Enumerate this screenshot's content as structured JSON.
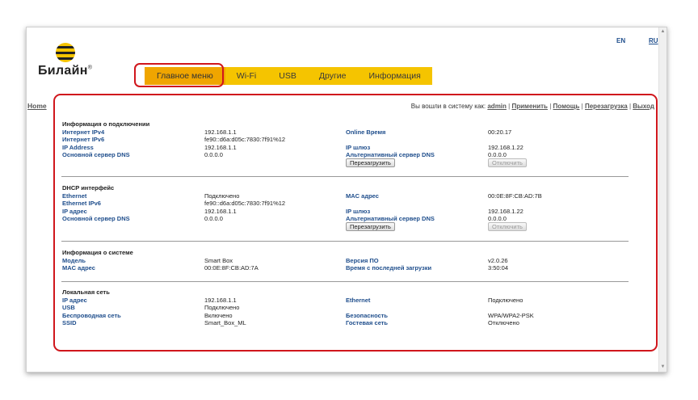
{
  "brand": {
    "name": "Билайн",
    "mark": "®"
  },
  "languages": {
    "en": "EN",
    "ru": "RU"
  },
  "menu": [
    {
      "label": "Главное меню",
      "active": true
    },
    {
      "label": "Wi-Fi"
    },
    {
      "label": "USB"
    },
    {
      "label": "Другие"
    },
    {
      "label": "Информация"
    }
  ],
  "home_link": "Home",
  "topbar": {
    "prefix": "Вы вошли в систему как:",
    "user": "admin",
    "apply": "Применить",
    "help": "Помощь",
    "reboot": "Перезагрузка",
    "logout": "Выход"
  },
  "connection": {
    "title": "Информация о подключении",
    "ipv4_label": "Интернет IPv4",
    "ipv4_value": "192.168.1.1",
    "ipv6_label": "Интернет IPv6",
    "ipv6_value": "fe90::d6a:d05c:7830:7f91%12",
    "ip_label": "IP Address",
    "ip_value": "192.168.1.1",
    "dns_label": "Основной сервер DNS",
    "dns_value": "0.0.0.0",
    "online_label": "Online Время",
    "online_value": "00:20.17",
    "gw_label": "IP шлюз",
    "gw_value": "192.168.1.22",
    "alt_dns_label": "Альтернативный сервер DNS",
    "alt_dns_value": "0.0.0.0",
    "restart_btn": "Перезагрузить",
    "disconnect_btn": "Отключить"
  },
  "dhcp": {
    "title": "DHCP интерфейс",
    "eth_label": "Ethernet",
    "eth_value": "Подключено",
    "ethv6_label": "Ethernet IPv6",
    "ethv6_value": "fe90::d6a:d05c:7830:7f91%12",
    "ip_label": "IP адрес",
    "ip_value": "192.168.1.1",
    "dns_label": "Основной сервер DNS",
    "dns_value": "0.0.0.0",
    "mac_label": "MAC адрес",
    "mac_value": "00:0E:8F:CB:AD:7B",
    "gw_label": "IP шлюз",
    "gw_value": "192.168.1.22",
    "alt_dns_label": "Альтернативный сервер DNS",
    "alt_dns_value": "0.0.0.0",
    "restart_btn": "Перезагрузить",
    "disconnect_btn": "Отключить"
  },
  "system": {
    "title": "Информация о системе",
    "model_label": "Модель",
    "model_value": "Smart Box",
    "mac_label": "MAC адрес",
    "mac_value": "00:0E:8F:CB:AD:7A",
    "fw_label": "Версия ПО",
    "fw_value": "v2.0.26",
    "uptime_label": "Время с последней загрузки",
    "uptime_value": "3:50:04"
  },
  "lan": {
    "title": "Локальная сеть",
    "ip_label": "IP адрес",
    "ip_value": "192.168.1.1",
    "usb_label": "USB",
    "usb_value": "Подключено",
    "wifi_label": "Беспроводная сеть",
    "wifi_value": "Включено",
    "ssid_label": "SSID",
    "ssid_value": "Smart_Box_ML",
    "eth_label": "Ethernet",
    "eth_value": "Подключено",
    "sec_label": "Безопасность",
    "sec_value": "WPA/WPA2-PSK",
    "guest_label": "Гостевая сеть",
    "guest_value": "Отключено"
  },
  "colors": {
    "accent": "#f5c400",
    "active_tab": "#f0a500",
    "label": "#1f4e8c",
    "highlight": "#d0161c"
  }
}
